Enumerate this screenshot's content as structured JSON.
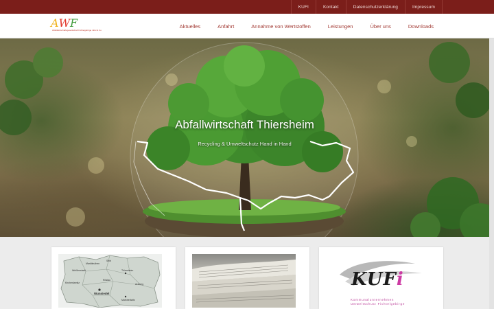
{
  "topbar": {
    "links": [
      "KUFI",
      "Kontakt",
      "Datenschutzerklärung",
      "Impressum"
    ]
  },
  "header": {
    "logo": {
      "letters": [
        "A",
        "W",
        "F"
      ],
      "tagline": "Abfallwirtschaftsgesellschaft Fichtelgebirge mbH & Co"
    },
    "nav": [
      "Aktuelles",
      "Anfahrt",
      "Annahme von Wertstoffen",
      "Leistungen",
      "Über uns",
      "Downloads"
    ]
  },
  "hero": {
    "title": "Abfallwirtschaft Thiersheim",
    "subtitle": "Recycling & Umweltschutz Hand in Hand"
  },
  "cards": {
    "map": {
      "labels": [
        "Weißenstadt",
        "Selb",
        "Marktleuthen",
        "Thiersheim",
        "Wunsiedel",
        "Marktredwitz",
        "Kirchenlamitz",
        "Arzberg",
        "Röslau"
      ]
    },
    "kufi": {
      "word_main": "KUF",
      "word_i": "i",
      "line1": "Kommunalunternehmen",
      "line2": "Umweltschutz Fichtelgebirge"
    }
  },
  "colors": {
    "topbar_bg": "#7b1e1a",
    "nav_text": "#a23a34",
    "tree_green": "#3f8a2c",
    "kufi_accent": "#cc3aa3"
  }
}
